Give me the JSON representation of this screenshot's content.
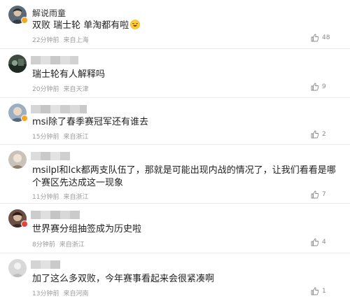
{
  "comments": [
    {
      "username": "解说雨童",
      "text": "双败 瑞士轮 单淘都有啦",
      "emoji": "laughing-face-emoji",
      "time": "22分钟前",
      "location": "来自上海",
      "likes": "48",
      "verified": true,
      "badge_color": "#f5a623"
    },
    {
      "username": "",
      "text": "瑞士轮有人解释吗",
      "time": "20分钟前",
      "location": "来自天津",
      "likes": "9"
    },
    {
      "username": "",
      "text": "msi除了春季赛冠军还有谁去",
      "time": "15分钟前",
      "location": "来自浙江",
      "likes": "2",
      "badge_color": "#f5a623"
    },
    {
      "username": "",
      "text_line1": "msilpl和lck都两支队伍了，那就是可能出现内战的情况了，让我们看看是哪",
      "text_line2": "个赛区先达成这一现象",
      "time": "11分钟前",
      "location": "来自浙江",
      "likes": "7"
    },
    {
      "username": "",
      "text": "世界赛分组抽签成为历史啦",
      "time": "8分钟前",
      "location": "来自浙江",
      "likes": "4",
      "badge_color": "#e5443a"
    },
    {
      "username": "",
      "text": "加了这么多双败，今年赛事看起来会很紧凑啊",
      "time": "13分钟前",
      "location": "来自河南",
      "likes": "1"
    }
  ],
  "colors": {
    "text": "#222222",
    "meta": "#9a9a9a",
    "divider": "#ececec",
    "mosaic": "#d6d6d6"
  },
  "icons": {
    "like": "thumbs-up-icon"
  }
}
